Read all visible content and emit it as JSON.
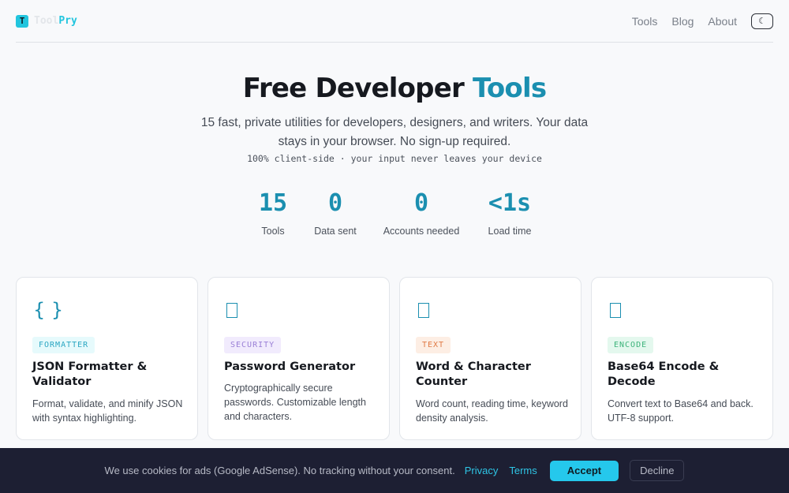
{
  "brand": {
    "logo_letter": "T",
    "name_part1": "Tool",
    "name_part2": "Pry"
  },
  "nav": {
    "items": [
      "Tools",
      "Blog",
      "About"
    ],
    "theme_toggle": "☾"
  },
  "hero": {
    "title_main": "Free Developer",
    "title_accent": "Tools",
    "subtitle": "15 fast, private utilities for developers, designers, and writers. Your data stays in your browser. No sign-up required.",
    "note": "100% client-side · your input never leaves your device"
  },
  "stats": [
    {
      "value": "15",
      "label": "Tools"
    },
    {
      "value": "0",
      "label": "Data sent"
    },
    {
      "value": "0",
      "label": "Accounts needed"
    },
    {
      "value": "<1s",
      "label": "Load time"
    }
  ],
  "cards": [
    {
      "icon": "{ }",
      "badge": "FORMATTER",
      "title": "JSON Formatter & Validator",
      "description": "Format, validate, and minify JSON with syntax highlighting."
    },
    {
      "icon": "box-icon",
      "badge": "SECURITY",
      "title": "Password Generator",
      "description": "Cryptographically secure passwords. Customizable length and characters."
    },
    {
      "icon": "box-icon",
      "badge": "TEXT",
      "title": "Word & Character Counter",
      "description": "Word count, reading time, keyword density analysis."
    },
    {
      "icon": "box-icon",
      "badge": "ENCODE",
      "title": "Base64 Encode & Decode",
      "description": "Convert text to Base64 and back. UTF-8 support."
    }
  ],
  "cookie": {
    "text": "We use cookies for ads (Google AdSense). No tracking without your consent.",
    "privacy_link": "Privacy",
    "terms_link": "Terms",
    "accept_label": "Accept",
    "decline_label": "Decline"
  },
  "colors": {
    "accent": "#1b8fb0",
    "brand_cyan": "#22c5de",
    "badge_formatter_bg": "#e6fafc",
    "badge_security_bg": "#f1ebfd",
    "badge_text_bg": "#fdeee4",
    "badge_encode_bg": "#e4f8ee",
    "cookie_bg": "#1d1f33"
  }
}
